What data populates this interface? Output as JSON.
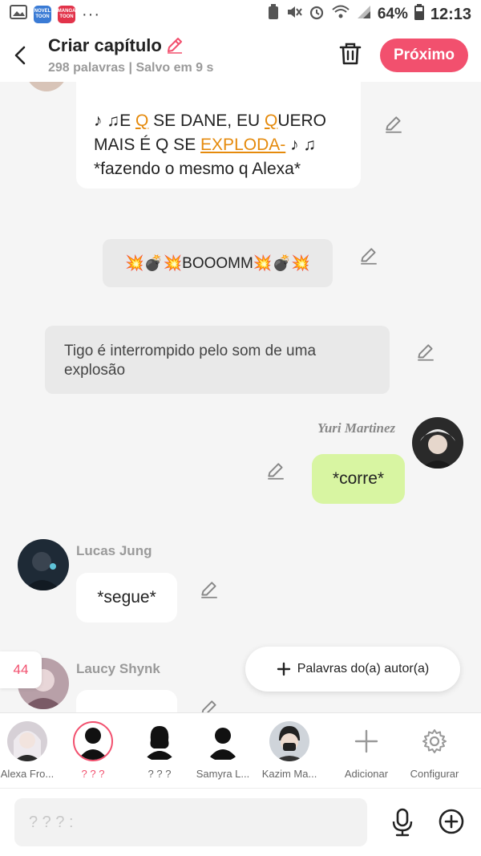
{
  "status_bar": {
    "apps": [
      {
        "icon": "gallery-icon"
      },
      {
        "name": "NOVEL TOON",
        "color": "#3a7bd5"
      },
      {
        "name": "MANGA TOON",
        "color": "#e2334a"
      }
    ],
    "more": "···",
    "battery": "64%",
    "time": "12:13"
  },
  "header": {
    "title": "Criar capítulo",
    "subtitle": "298 palavras | Salvo em 9 s",
    "next_label": "Próximo",
    "accent_color": "#f2506e"
  },
  "chat": {
    "messages": [
      {
        "type": "character",
        "lines": [
          [
            {
              "t": "♪ ♫E "
            },
            {
              "t": "Q",
              "hl": true
            },
            {
              "t": " SE DANE, EU "
            },
            {
              "t": "Q",
              "hl": true
            },
            {
              "t": "UERO"
            }
          ],
          [
            {
              "t": "MAIS É Q SE "
            },
            {
              "t": "EXPLODA-",
              "hl": true
            },
            {
              "t": " ♪ ♫"
            }
          ],
          [
            {
              "t": "*fazendo o mesmo q Alexa*"
            }
          ]
        ]
      },
      {
        "type": "effect",
        "text": "💥💣💥BOOOMM💥💣💥"
      },
      {
        "type": "narration",
        "text": "Tigo é interrompido pelo som de uma explosão"
      },
      {
        "type": "author",
        "name": "Yuri Martinez",
        "text": "*corre*"
      },
      {
        "type": "character",
        "name": "Lucas Jung",
        "text": "*segue*"
      },
      {
        "type": "character",
        "name": "Laucy Shynk",
        "text": ""
      }
    ]
  },
  "words_button": {
    "label": "Palavras do(a) autor(a)"
  },
  "count_badge": "44",
  "characters": [
    {
      "label": "Alexa Fro..."
    },
    {
      "label": "? ? ?",
      "selected": true
    },
    {
      "label": "? ? ?"
    },
    {
      "label": "Samyra L..."
    },
    {
      "label": "Kazim Ma..."
    }
  ],
  "actions": {
    "add": "Adicionar",
    "configure": "Configurar"
  },
  "input": {
    "placeholder": "? ? ? :"
  }
}
